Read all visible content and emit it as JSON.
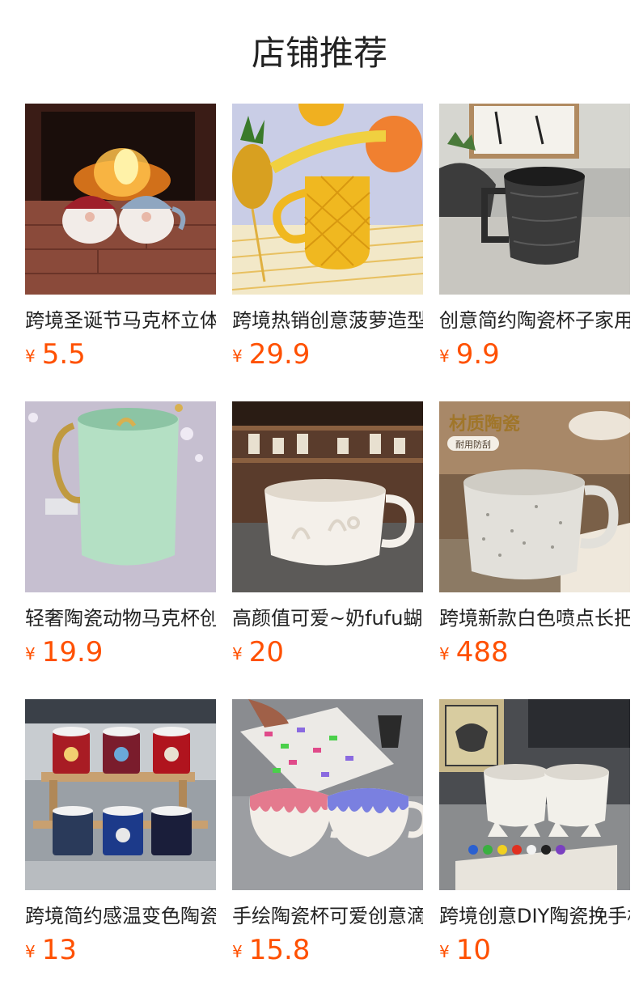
{
  "page_title": "店铺推荐",
  "accent_color": "#ff5000",
  "currency_symbol": "¥",
  "products": [
    {
      "title": "跨境圣诞节马克杯立体老人陶瓷杯",
      "price": "5.5",
      "image": "christmas-santa-mugs-by-fireplace"
    },
    {
      "title": "跨境热销创意菠萝造型陶瓷马克杯",
      "price": "29.9",
      "image": "yellow-pineapple-mug"
    },
    {
      "title": "创意简约陶瓷杯子家用咖啡杯",
      "price": "9.9",
      "image": "dark-faceted-mug"
    },
    {
      "title": "轻奢陶瓷动物马克杯创意水杯",
      "price": "19.9",
      "image": "mint-green-cat-ear-mug"
    },
    {
      "title": "高颜值可爱~奶fufu蝴蝶结陶瓷杯",
      "price": "20",
      "image": "white-embossed-mug-in-cafe"
    },
    {
      "title": "跨境新款白色喷点长把陶瓷杯",
      "price": "488",
      "image": "speckled-white-mug-with-badge"
    },
    {
      "title": "跨境简约感温变色陶瓷杯",
      "price": "13",
      "image": "football-club-mugs-on-shelf"
    },
    {
      "title": "手绘陶瓷杯可爱创意滴釉杯",
      "price": "15.8",
      "image": "drip-glaze-mugs"
    },
    {
      "title": "跨境创意DIY陶瓷挽手杯",
      "price": "10",
      "image": "diy-figure-mugs-with-paints"
    }
  ],
  "image_badges": {
    "speckled_headline": "材质陶瓷",
    "speckled_tag": "耐用防刮"
  }
}
